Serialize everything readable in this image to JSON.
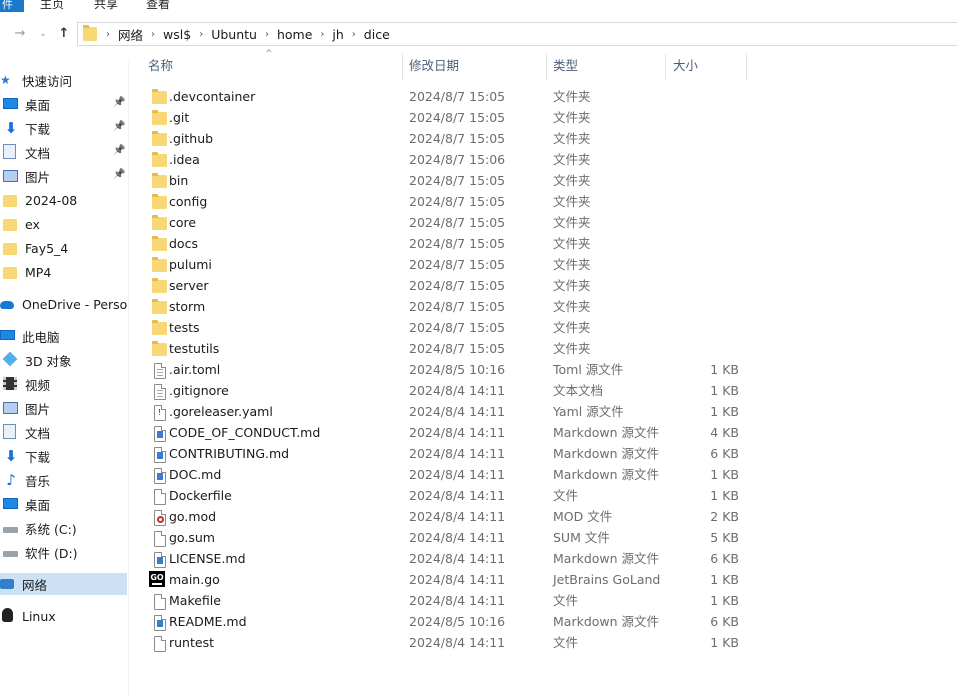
{
  "ribbon": {
    "file_tab": "件",
    "tabs": [
      "主页",
      "共享",
      "查看"
    ]
  },
  "nav": {
    "back_icon": "arrow-left-icon",
    "forward_icon": "arrow-right-icon",
    "recent_icon": "chevron-down-icon",
    "up_icon": "arrow-up-icon",
    "breadcrumbs": [
      "网络",
      "wsl$",
      "Ubuntu",
      "home",
      "jh",
      "dice"
    ]
  },
  "sidebar": {
    "items": [
      {
        "label": "快速访问",
        "icon": "star-icon",
        "pinned": false,
        "indent": 0
      },
      {
        "label": "桌面",
        "icon": "desktop-icon",
        "pinned": true,
        "indent": 1
      },
      {
        "label": "下载",
        "icon": "download-icon",
        "pinned": true,
        "indent": 1
      },
      {
        "label": "文档",
        "icon": "documents-icon",
        "pinned": true,
        "indent": 1
      },
      {
        "label": "图片",
        "icon": "pictures-icon",
        "pinned": true,
        "indent": 1
      },
      {
        "label": "2024-08",
        "icon": "folder-icon",
        "pinned": false,
        "indent": 1
      },
      {
        "label": "ex",
        "icon": "folder-icon",
        "pinned": false,
        "indent": 1
      },
      {
        "label": "Fay5_4",
        "icon": "folder-icon",
        "pinned": false,
        "indent": 1
      },
      {
        "label": "MP4",
        "icon": "folder-icon",
        "pinned": false,
        "indent": 1
      },
      {
        "label": "OneDrive - Persona",
        "icon": "onedrive-icon",
        "pinned": false,
        "indent": 0
      },
      {
        "label": "此电脑",
        "icon": "computer-icon",
        "pinned": false,
        "indent": 0
      },
      {
        "label": "3D 对象",
        "icon": "3d-objects-icon",
        "pinned": false,
        "indent": 1
      },
      {
        "label": "视频",
        "icon": "videos-icon",
        "pinned": false,
        "indent": 1
      },
      {
        "label": "图片",
        "icon": "pictures-icon",
        "pinned": false,
        "indent": 1
      },
      {
        "label": "文档",
        "icon": "documents-icon",
        "pinned": false,
        "indent": 1
      },
      {
        "label": "下载",
        "icon": "download-icon",
        "pinned": false,
        "indent": 1
      },
      {
        "label": "音乐",
        "icon": "music-icon",
        "pinned": false,
        "indent": 1
      },
      {
        "label": "桌面",
        "icon": "desktop-icon",
        "pinned": false,
        "indent": 1
      },
      {
        "label": "系统 (C:)",
        "icon": "drive-icon",
        "pinned": false,
        "indent": 1
      },
      {
        "label": "软件 (D:)",
        "icon": "drive-icon",
        "pinned": false,
        "indent": 1
      },
      {
        "label": "网络",
        "icon": "network-icon",
        "pinned": false,
        "indent": 0,
        "selected": true
      },
      {
        "label": "Linux",
        "icon": "linux-icon",
        "pinned": false,
        "indent": 0
      }
    ]
  },
  "columns": {
    "name": "名称",
    "modified": "修改日期",
    "type": "类型",
    "size": "大小"
  },
  "files": [
    {
      "name": ".devcontainer",
      "date": "2024/8/7 15:05",
      "type": "文件夹",
      "size": "",
      "icon": "folder"
    },
    {
      "name": ".git",
      "date": "2024/8/7 15:05",
      "type": "文件夹",
      "size": "",
      "icon": "folder"
    },
    {
      "name": ".github",
      "date": "2024/8/7 15:05",
      "type": "文件夹",
      "size": "",
      "icon": "folder"
    },
    {
      "name": ".idea",
      "date": "2024/8/7 15:06",
      "type": "文件夹",
      "size": "",
      "icon": "folder"
    },
    {
      "name": "bin",
      "date": "2024/8/7 15:05",
      "type": "文件夹",
      "size": "",
      "icon": "folder"
    },
    {
      "name": "config",
      "date": "2024/8/7 15:05",
      "type": "文件夹",
      "size": "",
      "icon": "folder"
    },
    {
      "name": "core",
      "date": "2024/8/7 15:05",
      "type": "文件夹",
      "size": "",
      "icon": "folder"
    },
    {
      "name": "docs",
      "date": "2024/8/7 15:05",
      "type": "文件夹",
      "size": "",
      "icon": "folder"
    },
    {
      "name": "pulumi",
      "date": "2024/8/7 15:05",
      "type": "文件夹",
      "size": "",
      "icon": "folder"
    },
    {
      "name": "server",
      "date": "2024/8/7 15:05",
      "type": "文件夹",
      "size": "",
      "icon": "folder"
    },
    {
      "name": "storm",
      "date": "2024/8/7 15:05",
      "type": "文件夹",
      "size": "",
      "icon": "folder"
    },
    {
      "name": "tests",
      "date": "2024/8/7 15:05",
      "type": "文件夹",
      "size": "",
      "icon": "folder"
    },
    {
      "name": "testutils",
      "date": "2024/8/7 15:05",
      "type": "文件夹",
      "size": "",
      "icon": "folder"
    },
    {
      "name": ".air.toml",
      "date": "2024/8/5 10:16",
      "type": "Toml 源文件",
      "size": "1 KB",
      "icon": "text"
    },
    {
      "name": ".gitignore",
      "date": "2024/8/4 14:11",
      "type": "文本文档",
      "size": "1 KB",
      "icon": "text"
    },
    {
      "name": ".goreleaser.yaml",
      "date": "2024/8/4 14:11",
      "type": "Yaml 源文件",
      "size": "1 KB",
      "icon": "yaml"
    },
    {
      "name": "CODE_OF_CONDUCT.md",
      "date": "2024/8/4 14:11",
      "type": "Markdown 源文件",
      "size": "4 KB",
      "icon": "markdown"
    },
    {
      "name": "CONTRIBUTING.md",
      "date": "2024/8/4 14:11",
      "type": "Markdown 源文件",
      "size": "6 KB",
      "icon": "markdown"
    },
    {
      "name": "DOC.md",
      "date": "2024/8/4 14:11",
      "type": "Markdown 源文件",
      "size": "1 KB",
      "icon": "markdown"
    },
    {
      "name": "Dockerfile",
      "date": "2024/8/4 14:11",
      "type": "文件",
      "size": "1 KB",
      "icon": "blank"
    },
    {
      "name": "go.mod",
      "date": "2024/8/4 14:11",
      "type": "MOD 文件",
      "size": "2 KB",
      "icon": "mod"
    },
    {
      "name": "go.sum",
      "date": "2024/8/4 14:11",
      "type": "SUM 文件",
      "size": "5 KB",
      "icon": "blank"
    },
    {
      "name": "LICENSE.md",
      "date": "2024/8/4 14:11",
      "type": "Markdown 源文件",
      "size": "6 KB",
      "icon": "markdown"
    },
    {
      "name": "main.go",
      "date": "2024/8/4 14:11",
      "type": "JetBrains GoLand",
      "size": "1 KB",
      "icon": "goland"
    },
    {
      "name": "Makefile",
      "date": "2024/8/4 14:11",
      "type": "文件",
      "size": "1 KB",
      "icon": "blank"
    },
    {
      "name": "README.md",
      "date": "2024/8/5 10:16",
      "type": "Markdown 源文件",
      "size": "6 KB",
      "icon": "markdown"
    },
    {
      "name": "runtest",
      "date": "2024/8/4 14:11",
      "type": "文件",
      "size": "1 KB",
      "icon": "blank"
    }
  ]
}
